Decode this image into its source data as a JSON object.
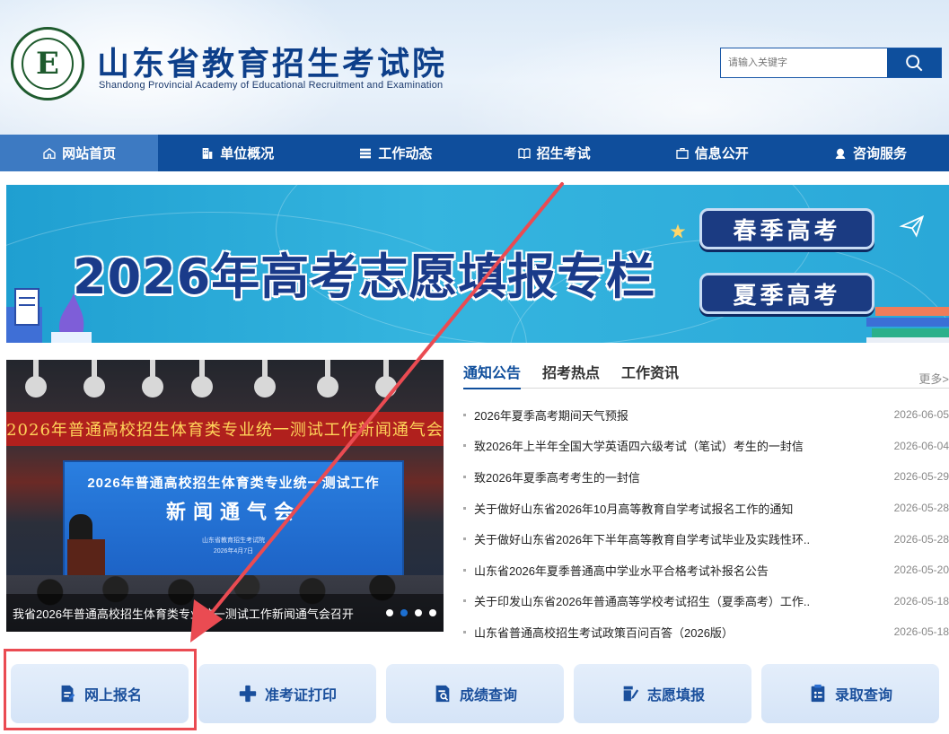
{
  "header": {
    "logo_letter": "E",
    "title": "山东省教育招生考试院",
    "subtitle": "Shandong Provincial Academy of Educational Recruitment and Examination",
    "search_placeholder": "请输入关键字",
    "search_icon": "search-icon"
  },
  "nav": {
    "items": [
      {
        "label": "网站首页",
        "icon": "home-icon"
      },
      {
        "label": "单位概况",
        "icon": "building-icon"
      },
      {
        "label": "工作动态",
        "icon": "server-icon"
      },
      {
        "label": "招生考试",
        "icon": "book-icon"
      },
      {
        "label": "信息公开",
        "icon": "briefcase-icon"
      },
      {
        "label": "咨询服务",
        "icon": "headset-icon"
      }
    ]
  },
  "banner": {
    "title": "2026年高考志愿填报专栏",
    "btn_spring": "春季高考",
    "btn_summer": "夏季高考"
  },
  "slider": {
    "red_banner": "2026年普通高校招生体育类专业统一测试工作新闻通气会",
    "screen_line1": "2026年普通高校招生体育类专业统一测试工作",
    "screen_line2": "新闻通气会",
    "screen_line3": "山东省教育招生考试院",
    "screen_line4": "2026年4月7日",
    "caption": "我省2026年普通高校招生体育类专业统一测试工作新闻通气会召开"
  },
  "news": {
    "tabs": [
      "通知公告",
      "招考热点",
      "工作资讯"
    ],
    "more": "更多>",
    "items": [
      {
        "title": "2026年夏季高考期间天气预报",
        "date": "2026-06-05"
      },
      {
        "title": "致2026年上半年全国大学英语四六级考试（笔试）考生的一封信",
        "date": "2026-06-04"
      },
      {
        "title": "致2026年夏季高考考生的一封信",
        "date": "2026-05-29"
      },
      {
        "title": "关于做好山东省2026年10月高等教育自学考试报名工作的通知",
        "date": "2026-05-28"
      },
      {
        "title": "关于做好山东省2026年下半年高等教育自学考试毕业及实践性环..",
        "date": "2026-05-28"
      },
      {
        "title": "山东省2026年夏季普通高中学业水平合格考试补报名公告",
        "date": "2026-05-20"
      },
      {
        "title": "关于印发山东省2026年普通高等学校考试招生（夏季高考）工作..",
        "date": "2026-05-18"
      },
      {
        "title": "山东省普通高校招生考试政策百问百答（2026版）",
        "date": "2026-05-18"
      }
    ]
  },
  "quick": {
    "items": [
      {
        "label": "网上报名",
        "icon": "edit-doc-icon"
      },
      {
        "label": "准考证打印",
        "icon": "plus-icon"
      },
      {
        "label": "成绩查询",
        "icon": "search-doc-icon"
      },
      {
        "label": "志愿填报",
        "icon": "pen-doc-icon"
      },
      {
        "label": "录取查询",
        "icon": "clipboard-icon"
      }
    ]
  },
  "colors": {
    "primary": "#0f4e9c",
    "nav_active": "#3d7ac2",
    "annotation_red": "#ea4b52",
    "banner_blue": "#2aa8d8"
  }
}
